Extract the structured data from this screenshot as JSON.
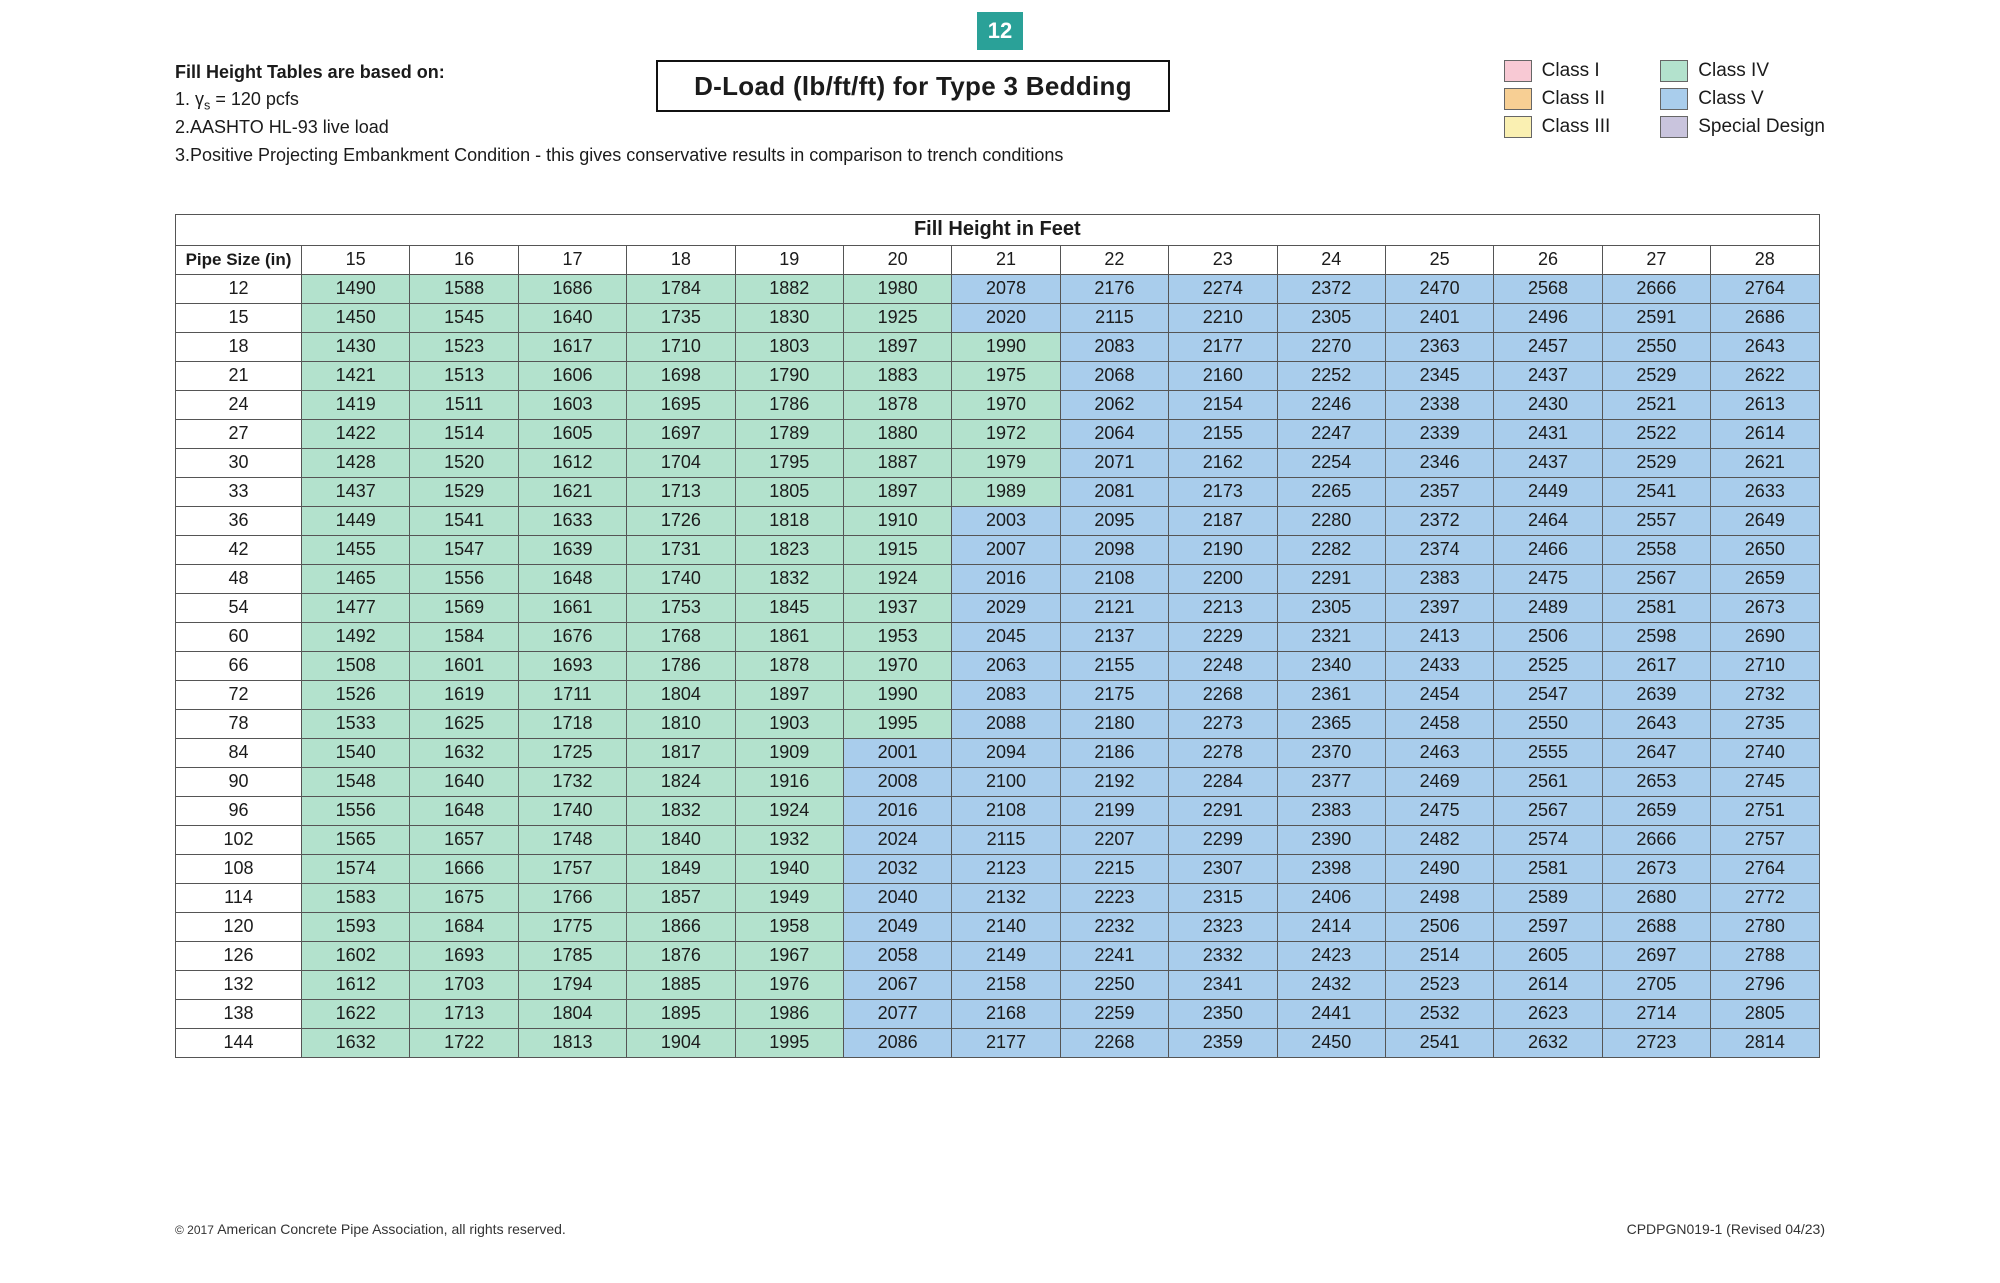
{
  "page_number": "12",
  "notes": {
    "title": "Fill Height Tables are based on:",
    "items": [
      {
        "prefix": "1. ",
        "symbol": "γ",
        "sub": "s",
        "rest": " = 120 pcfs"
      },
      {
        "prefix": "2.",
        "rest": "AASHTO HL-93 live load"
      }
    ],
    "long": "3.Positive Projecting Embankment Condition - this gives conservative results in comparison to trench conditions"
  },
  "panel_title": "D-Load (lb/ft/ft) for Type 3 Bedding",
  "legend": {
    "col1": [
      {
        "label": "Class I",
        "cls": "c1"
      },
      {
        "label": "Class II",
        "cls": "c2"
      },
      {
        "label": "Class III",
        "cls": "c3"
      }
    ],
    "col2": [
      {
        "label": "Class IV",
        "cls": "c4"
      },
      {
        "label": "Class V",
        "cls": "c5"
      },
      {
        "label": "Special Design",
        "cls": "c6"
      }
    ]
  },
  "table": {
    "super_header": "Fill Height in Feet",
    "corner": "Pipe Size (in)",
    "fill_heights": [
      15,
      16,
      17,
      18,
      19,
      20,
      21,
      22,
      23,
      24,
      25,
      26,
      27,
      28
    ],
    "pipe_sizes": [
      12,
      15,
      18,
      21,
      24,
      27,
      30,
      33,
      36,
      42,
      48,
      54,
      60,
      66,
      72,
      78,
      84,
      90,
      96,
      102,
      108,
      114,
      120,
      126,
      132,
      138,
      144
    ],
    "values": [
      [
        1490,
        1588,
        1686,
        1784,
        1882,
        1980,
        2078,
        2176,
        2274,
        2372,
        2470,
        2568,
        2666,
        2764
      ],
      [
        1450,
        1545,
        1640,
        1735,
        1830,
        1925,
        2020,
        2115,
        2210,
        2305,
        2401,
        2496,
        2591,
        2686
      ],
      [
        1430,
        1523,
        1617,
        1710,
        1803,
        1897,
        1990,
        2083,
        2177,
        2270,
        2363,
        2457,
        2550,
        2643
      ],
      [
        1421,
        1513,
        1606,
        1698,
        1790,
        1883,
        1975,
        2068,
        2160,
        2252,
        2345,
        2437,
        2529,
        2622
      ],
      [
        1419,
        1511,
        1603,
        1695,
        1786,
        1878,
        1970,
        2062,
        2154,
        2246,
        2338,
        2430,
        2521,
        2613
      ],
      [
        1422,
        1514,
        1605,
        1697,
        1789,
        1880,
        1972,
        2064,
        2155,
        2247,
        2339,
        2431,
        2522,
        2614
      ],
      [
        1428,
        1520,
        1612,
        1704,
        1795,
        1887,
        1979,
        2071,
        2162,
        2254,
        2346,
        2437,
        2529,
        2621
      ],
      [
        1437,
        1529,
        1621,
        1713,
        1805,
        1897,
        1989,
        2081,
        2173,
        2265,
        2357,
        2449,
        2541,
        2633
      ],
      [
        1449,
        1541,
        1633,
        1726,
        1818,
        1910,
        2003,
        2095,
        2187,
        2280,
        2372,
        2464,
        2557,
        2649
      ],
      [
        1455,
        1547,
        1639,
        1731,
        1823,
        1915,
        2007,
        2098,
        2190,
        2282,
        2374,
        2466,
        2558,
        2650
      ],
      [
        1465,
        1556,
        1648,
        1740,
        1832,
        1924,
        2016,
        2108,
        2200,
        2291,
        2383,
        2475,
        2567,
        2659
      ],
      [
        1477,
        1569,
        1661,
        1753,
        1845,
        1937,
        2029,
        2121,
        2213,
        2305,
        2397,
        2489,
        2581,
        2673
      ],
      [
        1492,
        1584,
        1676,
        1768,
        1861,
        1953,
        2045,
        2137,
        2229,
        2321,
        2413,
        2506,
        2598,
        2690
      ],
      [
        1508,
        1601,
        1693,
        1786,
        1878,
        1970,
        2063,
        2155,
        2248,
        2340,
        2433,
        2525,
        2617,
        2710
      ],
      [
        1526,
        1619,
        1711,
        1804,
        1897,
        1990,
        2083,
        2175,
        2268,
        2361,
        2454,
        2547,
        2639,
        2732
      ],
      [
        1533,
        1625,
        1718,
        1810,
        1903,
        1995,
        2088,
        2180,
        2273,
        2365,
        2458,
        2550,
        2643,
        2735
      ],
      [
        1540,
        1632,
        1725,
        1817,
        1909,
        2001,
        2094,
        2186,
        2278,
        2370,
        2463,
        2555,
        2647,
        2740
      ],
      [
        1548,
        1640,
        1732,
        1824,
        1916,
        2008,
        2100,
        2192,
        2284,
        2377,
        2469,
        2561,
        2653,
        2745
      ],
      [
        1556,
        1648,
        1740,
        1832,
        1924,
        2016,
        2108,
        2199,
        2291,
        2383,
        2475,
        2567,
        2659,
        2751
      ],
      [
        1565,
        1657,
        1748,
        1840,
        1932,
        2024,
        2115,
        2207,
        2299,
        2390,
        2482,
        2574,
        2666,
        2757
      ],
      [
        1574,
        1666,
        1757,
        1849,
        1940,
        2032,
        2123,
        2215,
        2307,
        2398,
        2490,
        2581,
        2673,
        2764
      ],
      [
        1583,
        1675,
        1766,
        1857,
        1949,
        2040,
        2132,
        2223,
        2315,
        2406,
        2498,
        2589,
        2680,
        2772
      ],
      [
        1593,
        1684,
        1775,
        1866,
        1958,
        2049,
        2140,
        2232,
        2323,
        2414,
        2506,
        2597,
        2688,
        2780
      ],
      [
        1602,
        1693,
        1785,
        1876,
        1967,
        2058,
        2149,
        2241,
        2332,
        2423,
        2514,
        2605,
        2697,
        2788
      ],
      [
        1612,
        1703,
        1794,
        1885,
        1976,
        2067,
        2158,
        2250,
        2341,
        2432,
        2523,
        2614,
        2705,
        2796
      ],
      [
        1622,
        1713,
        1804,
        1895,
        1986,
        2077,
        2168,
        2259,
        2350,
        2441,
        2532,
        2623,
        2714,
        2805
      ],
      [
        1632,
        1722,
        1813,
        1904,
        1995,
        2086,
        2177,
        2268,
        2359,
        2450,
        2541,
        2632,
        2723,
        2814
      ]
    ]
  },
  "thresholds": {
    "class5": 2000
  },
  "footer": {
    "left_prefix": "© 2017 ",
    "left_rest": "American Concrete Pipe Association, all rights reserved.",
    "right": "CPDPGN019-1 (Revised 04/23)"
  }
}
